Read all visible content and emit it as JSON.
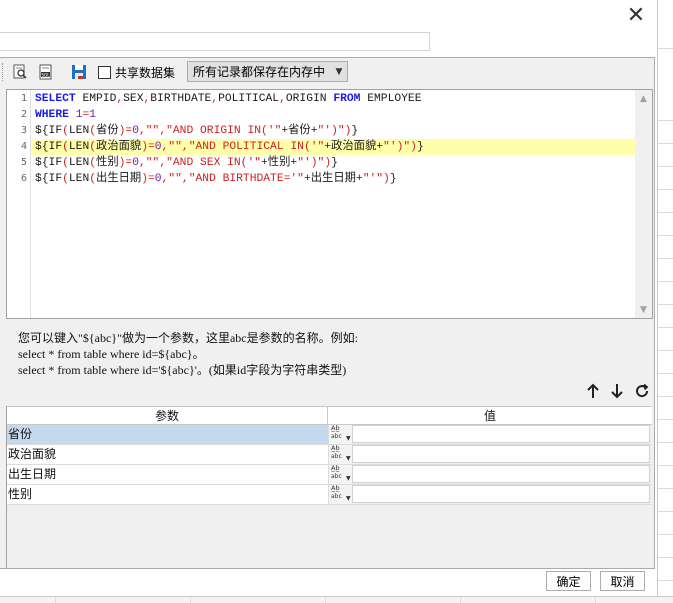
{
  "dialog": {
    "close_glyph": "✕"
  },
  "toolbar": {
    "share_dataset_label": "共享数据集",
    "cache_select_value": "所有记录都保存在内存中",
    "icons": [
      "find-replace-icon",
      "sql-icon",
      "save-icon"
    ]
  },
  "editor": {
    "line_numbers": [
      "1",
      "2",
      "3",
      "4",
      "5",
      "6"
    ],
    "highlighted_line": 4,
    "lines": [
      "SELECT EMPID,SEX,BIRTHDATE,POLITICAL,ORIGIN FROM EMPLOYEE",
      "WHERE 1=1",
      "${IF(LEN(省份)=0,\"\",\"AND ORIGIN IN('\"+省份+\"')\")}",
      "${IF(LEN(政治面貌)=0,\"\",\"AND POLITICAL IN('\"+政治面貌+\"')\")}",
      "${IF(LEN(性别)=0,\"\",\"AND SEX IN('\"+性别+\"')\")}",
      "${IF(LEN(出生日期)=0,\"\",\"AND BIRTHDATE='\"+出生日期+\"'\")}"
    ]
  },
  "help": {
    "line1": "您可以键入\"${abc}\"做为一个参数，这里abc是参数的名称。例如:",
    "line2": "select * from table where id=${abc}。",
    "line3": "select * from table where id='${abc}'。(如果id字段为字符串类型)"
  },
  "param_table": {
    "header_name": "参数",
    "header_value": "值",
    "type_icon_top": "A̲b̲",
    "type_icon_bottom": "abc",
    "rows": [
      {
        "name": "省份",
        "value": "",
        "selected": true
      },
      {
        "name": "政治面貌",
        "value": "",
        "selected": false
      },
      {
        "name": "出生日期",
        "value": "",
        "selected": false
      },
      {
        "name": "性别",
        "value": "",
        "selected": false
      }
    ]
  },
  "footer": {
    "ok_label": "确定",
    "cancel_label": "取消"
  }
}
